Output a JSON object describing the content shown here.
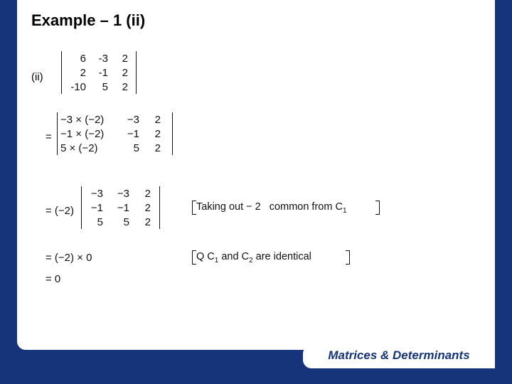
{
  "title": "Example – 1 (ii)",
  "partLabel": "(ii)",
  "det1": {
    "rows": [
      [
        "6",
        "-3",
        "2"
      ],
      [
        "2",
        "-1",
        "2"
      ],
      [
        "-10",
        "5",
        "2"
      ]
    ]
  },
  "step2": {
    "prefix": "=",
    "rows": [
      [
        "−3 × (−2)",
        "−3",
        "2"
      ],
      [
        "−1 × (−2)",
        "−1",
        "2"
      ],
      [
        "5 × (−2)",
        "5",
        "2"
      ]
    ]
  },
  "step3": {
    "prefix": "= (−2)",
    "rows": [
      [
        "−3",
        "−3",
        "2"
      ],
      [
        "−1",
        "−1",
        "2"
      ],
      [
        "5",
        "5",
        "2"
      ]
    ]
  },
  "comment3a": "Taking out − 2",
  "comment3b": "common from C",
  "comment3sub": "1",
  "step4": {
    "line": "= (−2) × 0"
  },
  "comment4a": "Q  C",
  "comment4s1": "1",
  "comment4b": " and C",
  "comment4s2": "2",
  "comment4c": " are  identical",
  "step5": {
    "line": "= 0"
  },
  "footer": "Matrices & Determinants",
  "chart_data": {
    "type": "table",
    "title": "Determinant evaluation",
    "matrix": [
      [
        6,
        -3,
        2
      ],
      [
        2,
        -1,
        2
      ],
      [
        -10,
        5,
        2
      ]
    ],
    "result": 0
  }
}
